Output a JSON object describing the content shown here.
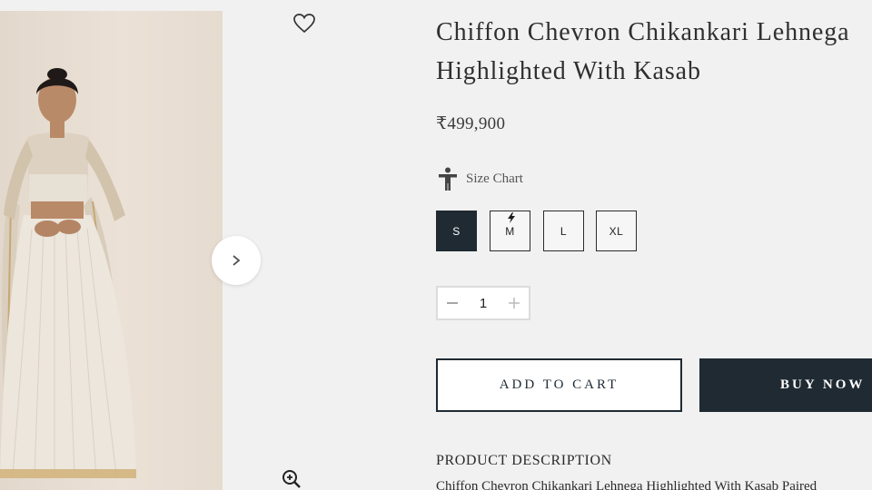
{
  "product": {
    "title_line1": "Chiffon Chevron Chikankari Lehnega",
    "title_line2": "Highlighted With Kasab",
    "price": "₹499,900",
    "image_alt": "Model wearing ivory chikankari lehenga with embellished sheer blouse and dupatta"
  },
  "size_chart": {
    "icon": "size-chart-person-icon",
    "label": "Size Chart"
  },
  "sizes": {
    "options": [
      "S",
      "M",
      "L",
      "XL"
    ],
    "selected": "S",
    "fast_ship_icon_on": "M"
  },
  "quantity": {
    "value": "1",
    "minus_icon": "minus-icon",
    "plus_icon": "plus-icon"
  },
  "actions": {
    "add_to_cart_label": "ADD TO CART",
    "buy_now_label": "BUY NOW"
  },
  "description": {
    "heading": "PRODUCT DESCRIPTION",
    "text": "Chiffon Chevron Chikankari Lehnega Highlighted With Kasab Paired"
  },
  "icons": {
    "wishlist": "heart-outline-icon",
    "next": "chevron-right-icon",
    "zoom": "zoom-in-icon"
  },
  "colors": {
    "primary_dark": "#1f2a33",
    "background": "#f1f1f1"
  }
}
